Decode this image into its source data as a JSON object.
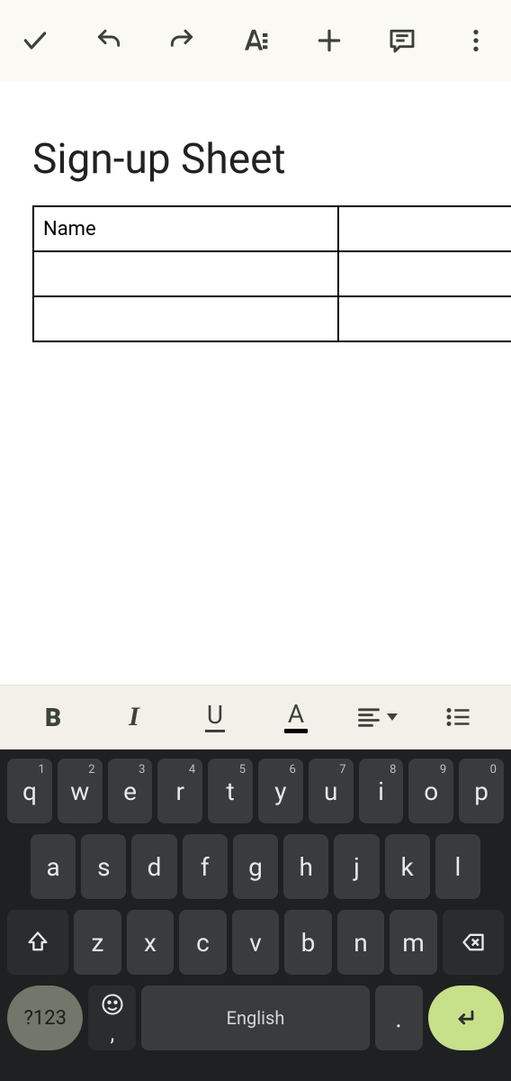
{
  "toolbar": {
    "done": "done",
    "undo": "undo",
    "redo": "redo",
    "textformat": "textformat",
    "insert": "insert",
    "comment": "comment",
    "more": "more"
  },
  "doc": {
    "title": "Sign-up Sheet",
    "table": {
      "rows": [
        {
          "c1": "Name",
          "c2": ""
        },
        {
          "c1": "",
          "c2": ""
        },
        {
          "c1": "",
          "c2": ""
        }
      ]
    }
  },
  "format": {
    "bold": "B",
    "italic": "I",
    "underline": "U",
    "textcolor": "A"
  },
  "keyboard": {
    "row1": [
      {
        "k": "q",
        "h": "1"
      },
      {
        "k": "w",
        "h": "2"
      },
      {
        "k": "e",
        "h": "3"
      },
      {
        "k": "r",
        "h": "4"
      },
      {
        "k": "t",
        "h": "5"
      },
      {
        "k": "y",
        "h": "6"
      },
      {
        "k": "u",
        "h": "7"
      },
      {
        "k": "i",
        "h": "8"
      },
      {
        "k": "o",
        "h": "9"
      },
      {
        "k": "p",
        "h": "0"
      }
    ],
    "row2": [
      {
        "k": "a"
      },
      {
        "k": "s"
      },
      {
        "k": "d"
      },
      {
        "k": "f"
      },
      {
        "k": "g"
      },
      {
        "k": "h"
      },
      {
        "k": "j"
      },
      {
        "k": "k"
      },
      {
        "k": "l"
      }
    ],
    "row3": [
      {
        "k": "z"
      },
      {
        "k": "x"
      },
      {
        "k": "c"
      },
      {
        "k": "v"
      },
      {
        "k": "b"
      },
      {
        "k": "n"
      },
      {
        "k": "m"
      }
    ],
    "symbols": "?123",
    "comma": ",",
    "space": "English",
    "period": "."
  }
}
